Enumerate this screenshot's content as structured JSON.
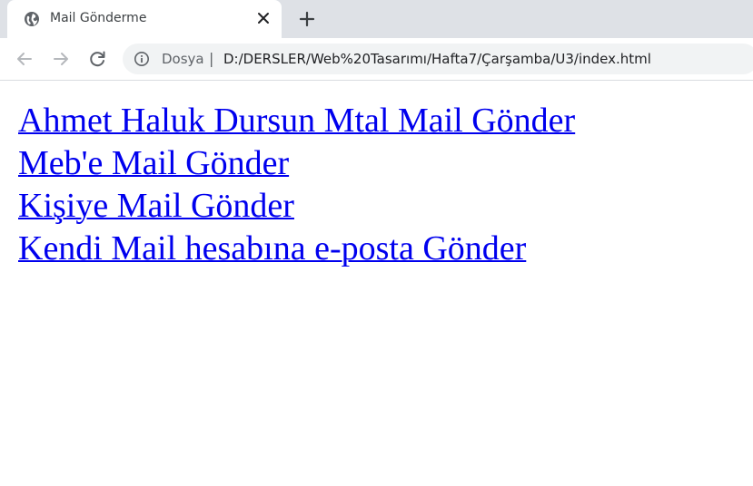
{
  "tab": {
    "title": "Mail Gönderme"
  },
  "address_bar": {
    "chip_label": "Dosya",
    "separator": "|",
    "url": "D:/DERSLER/Web%20Tasarımı/Hafta7/Çarşamba/U3/index.html"
  },
  "links": [
    {
      "text": "Ahmet Haluk Dursun Mtal Mail Gönder"
    },
    {
      "text": "Meb'e Mail Gönder"
    },
    {
      "text": "Kişiye Mail Gönder"
    },
    {
      "text": "Kendi Mail hesabına e-posta Gönder"
    }
  ],
  "colors": {
    "link": "#0000ee",
    "tabstrip": "#dee1e6",
    "omnibox": "#f1f3f4"
  },
  "icons": {
    "favicon": "globe-icon",
    "tab_close": "close-icon",
    "new_tab": "plus-icon",
    "back": "arrow-left-icon",
    "forward": "arrow-right-icon",
    "reload": "reload-icon",
    "site_info": "info-icon"
  }
}
